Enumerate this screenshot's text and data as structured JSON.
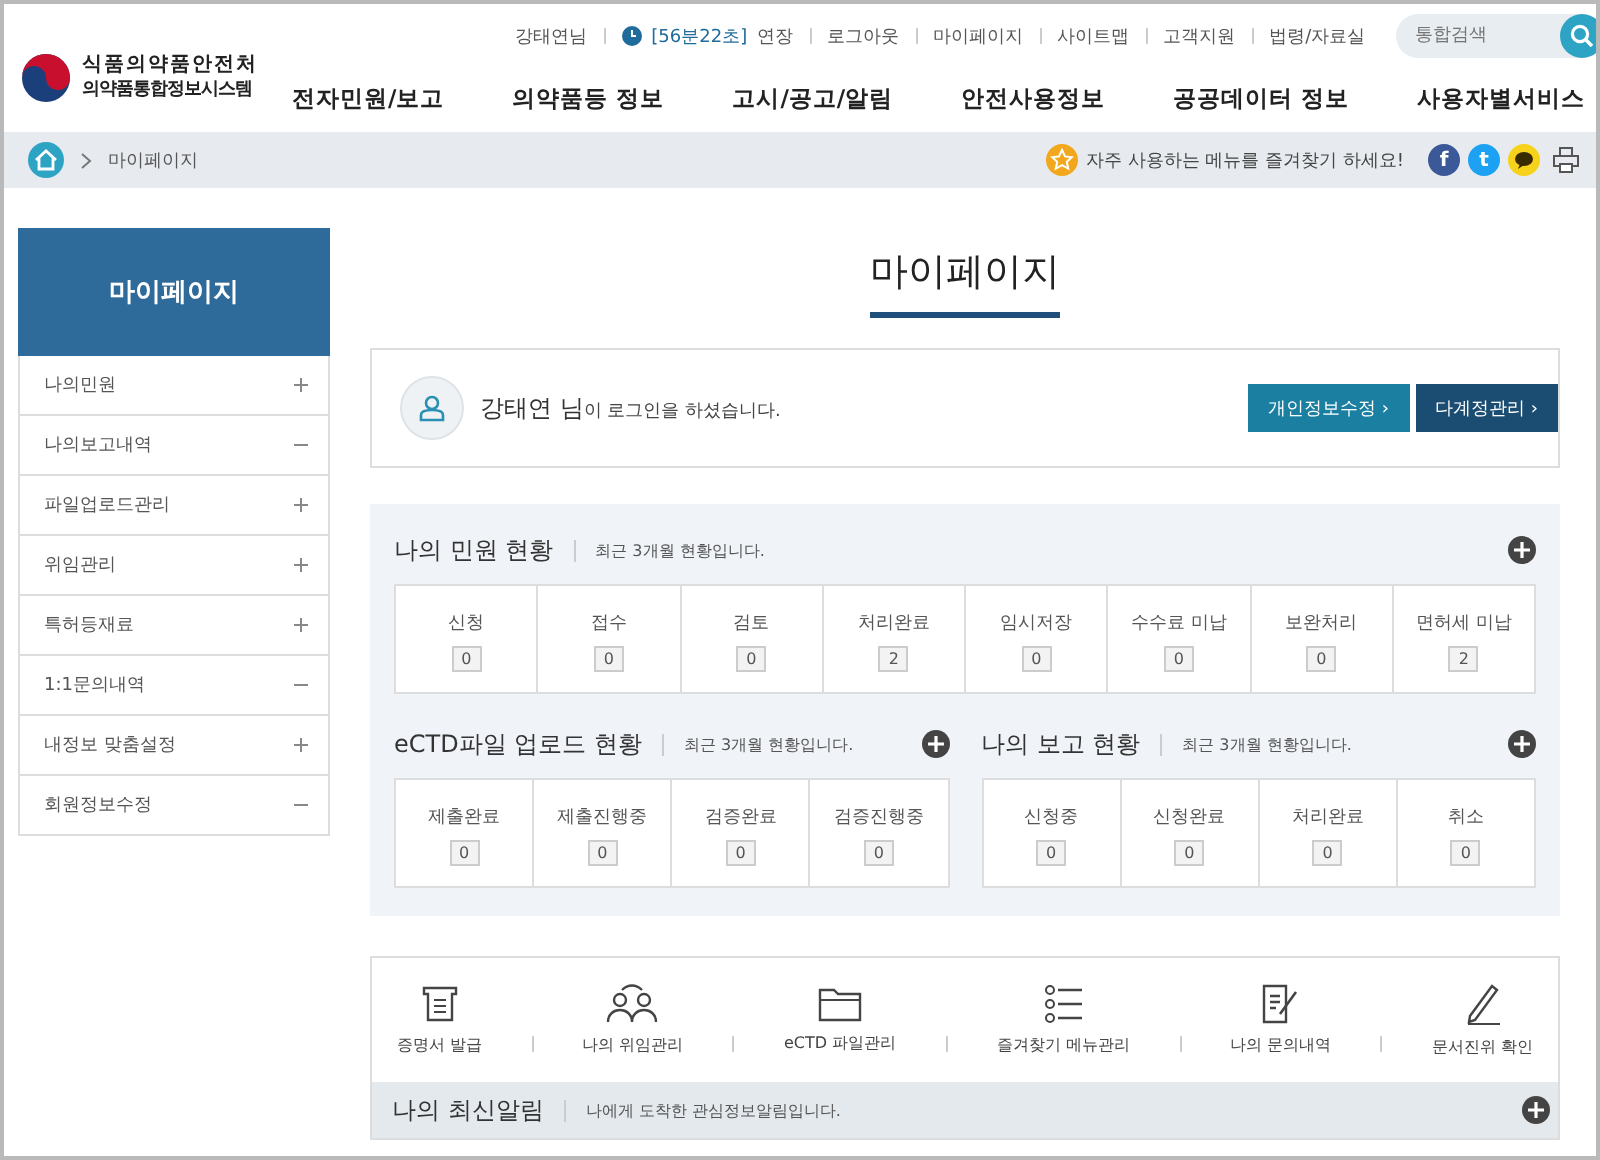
{
  "header": {
    "logo_top": "식품의약품안전처",
    "logo_bottom": "의약품통합정보시스템",
    "user": "강태연님",
    "session": "[56분22초]",
    "extend": "연장",
    "links": [
      "로그아웃",
      "마이페이지",
      "사이트맵",
      "고객지원",
      "법령/자료실"
    ],
    "search": {
      "placeholder": "통합검색"
    },
    "nav": [
      "전자민원/보고",
      "의약품등 정보",
      "고시/공고/알림",
      "안전사용정보",
      "공공데이터 정보",
      "사용자별서비스"
    ]
  },
  "breadcrumb": {
    "current": "마이페이지",
    "favorite_tip": "자주 사용하는 메뉴를 즐겨찾기 하세요!",
    "social": [
      "f",
      "t"
    ]
  },
  "sidebar": {
    "title": "마이페이지",
    "items": [
      {
        "label": "나의민원",
        "expanded": false
      },
      {
        "label": "나의보고내역",
        "expanded": true
      },
      {
        "label": "파일업로드관리",
        "expanded": false
      },
      {
        "label": "위임관리",
        "expanded": false
      },
      {
        "label": "특허등재료",
        "expanded": false
      },
      {
        "label": "1:1문의내역",
        "expanded": true
      },
      {
        "label": "내정보 맞춤설정",
        "expanded": false
      },
      {
        "label": "회원정보수정",
        "expanded": true
      }
    ]
  },
  "page_title": "마이페이지",
  "user_card": {
    "text": "**강태연 님**이 로그인을 하셨습니다.",
    "buttons": [
      "개인정보수정 ›",
      "다계정관리 ›"
    ]
  },
  "panels": [
    {
      "title": "나의 민원 현황",
      "subtitle": "최근 3개월 현황입니다.",
      "cells": [
        {
          "label": "신청",
          "count": "0"
        },
        {
          "label": "접수",
          "count": "0"
        },
        {
          "label": "검토",
          "count": "0"
        },
        {
          "label": "처리완료",
          "count": "2"
        },
        {
          "label": "임시저장",
          "count": "0"
        },
        {
          "label": "수수료 미납",
          "count": "0"
        },
        {
          "label": "보완처리",
          "count": "0"
        },
        {
          "label": "면허세 미납",
          "count": "2"
        }
      ]
    },
    {
      "title": "eCTD파일 업로드 현황",
      "subtitle": "최근 3개월 현황입니다.",
      "cells": [
        {
          "label": "제출완료",
          "count": "0"
        },
        {
          "label": "제출진행중",
          "count": "0"
        },
        {
          "label": "검증완료",
          "count": "0"
        },
        {
          "label": "검증진행중",
          "count": "0"
        }
      ]
    },
    {
      "title": "나의 보고 현황",
      "subtitle": "최근 3개월 현황입니다.",
      "cells": [
        {
          "label": "신청중",
          "count": "0"
        },
        {
          "label": "신청완료",
          "count": "0"
        },
        {
          "label": "처리완료",
          "count": "0"
        },
        {
          "label": "취소",
          "count": "0"
        }
      ]
    }
  ],
  "quick_menu": [
    {
      "kind": "certificate",
      "label": "증명서 발급"
    },
    {
      "kind": "people",
      "label": "나의 위임관리"
    },
    {
      "kind": "folder",
      "label": "eCTD 파일관리"
    },
    {
      "kind": "list",
      "label": "즐겨찾기 메뉴관리"
    },
    {
      "kind": "document",
      "label": "나의 문의내역"
    },
    {
      "kind": "pen",
      "label": "문서진위 확인"
    }
  ],
  "alerts": {
    "title": "나의 최신알림",
    "subtitle": "나에게 도착한 관심정보알림입니다."
  }
}
